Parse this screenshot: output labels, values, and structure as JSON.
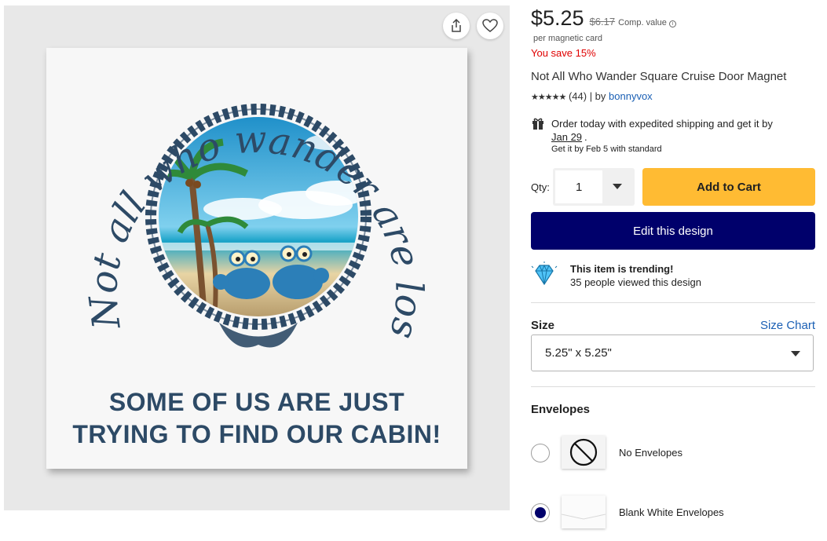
{
  "product_image": {
    "arc_text": "Not all who wander are lost...",
    "tagline_line1": "SOME OF US ARE JUST",
    "tagline_line2": "TRYING TO FIND OUR CABIN!"
  },
  "gallery_actions": {
    "share_icon": "share-icon",
    "favorite_icon": "heart-icon"
  },
  "pricing": {
    "price": "$5.25",
    "original_price": "$6.17",
    "comp_label": "Comp. value",
    "per_unit": "per magnetic card",
    "savings": "You save 15%"
  },
  "product": {
    "title": "Not All Who Wander Square Cruise Door Magnet",
    "stars": "★★★★★",
    "review_count": "(44)",
    "by_label": "| by",
    "author": "bonnyvox"
  },
  "shipping": {
    "line1": "Order today with expedited shipping and get it by",
    "date": "Jan 29",
    "line3": "Get it by Feb 5 with standard"
  },
  "purchase": {
    "qty_label": "Qty:",
    "qty_value": "1",
    "add_to_cart": "Add to Cart",
    "edit_design": "Edit this design"
  },
  "trending": {
    "heading": "This item is trending!",
    "subtext": "35 people viewed this design"
  },
  "size": {
    "label": "Size",
    "chart_link": "Size Chart",
    "selected": "5.25\" x 5.25\""
  },
  "envelopes": {
    "label": "Envelopes",
    "options": [
      {
        "label": "No Envelopes",
        "selected": false
      },
      {
        "label": "Blank White Envelopes",
        "selected": true
      }
    ]
  },
  "colors": {
    "accent_yellow": "#ffbb33",
    "brand_navy": "#00006b",
    "sale_red": "#e00000",
    "link_blue": "#1a5fb4",
    "design_navy": "#2d4a66"
  }
}
